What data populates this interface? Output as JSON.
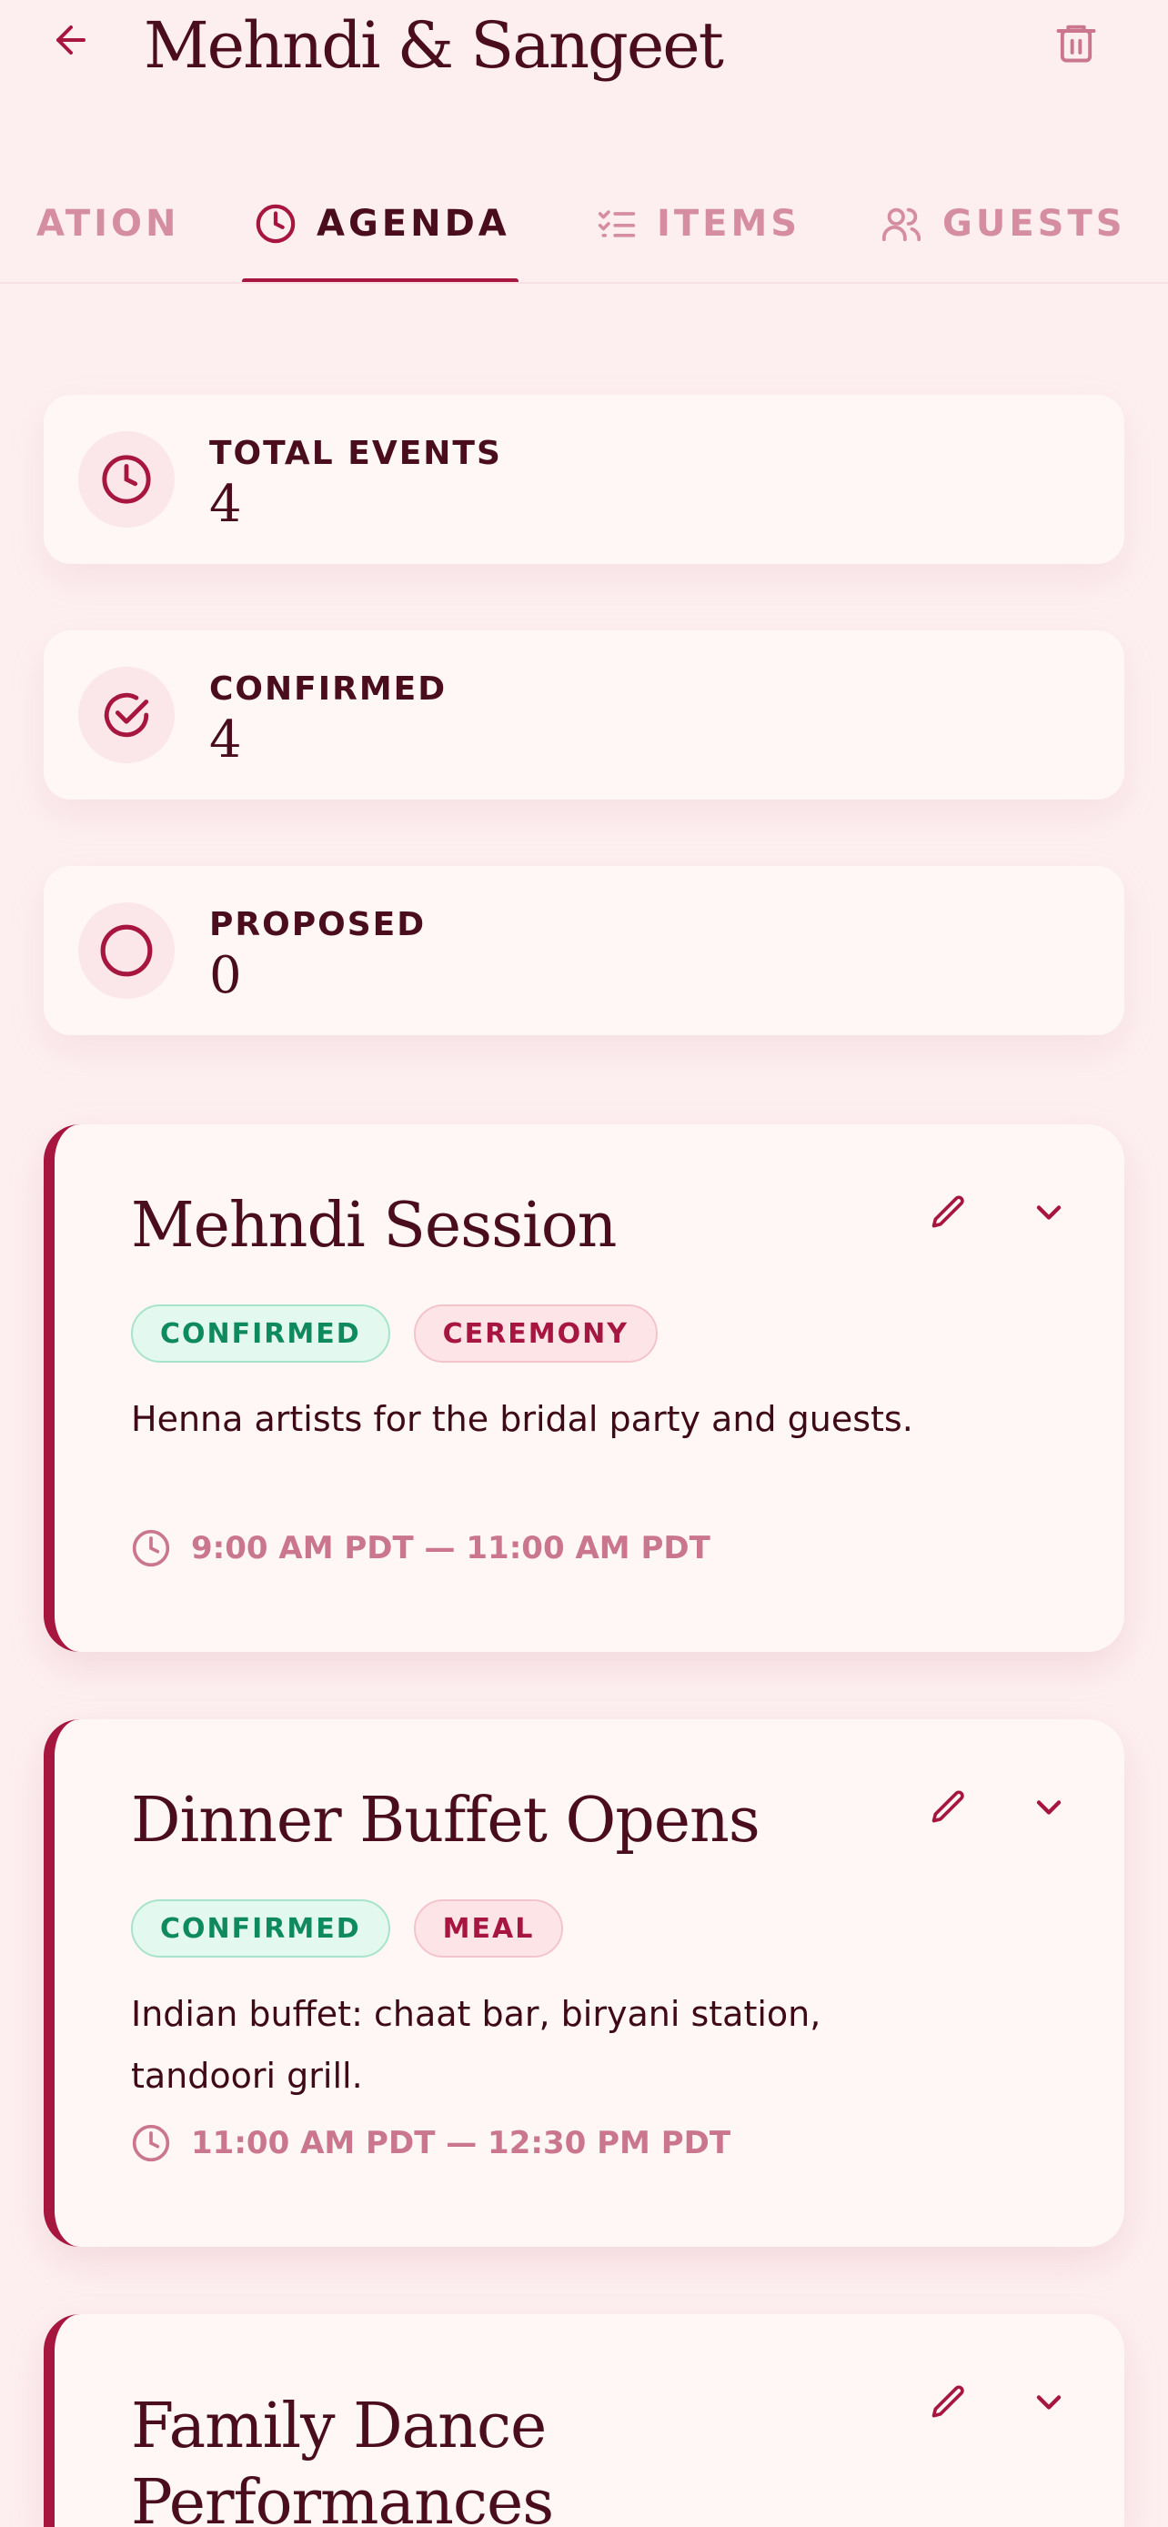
{
  "header": {
    "title": "Mehndi & Sangeet"
  },
  "tabs": [
    {
      "label": "ATION",
      "icon": "none",
      "active": false
    },
    {
      "label": "AGENDA",
      "icon": "clock-icon",
      "active": true
    },
    {
      "label": "ITEMS",
      "icon": "checklist-icon",
      "active": false
    },
    {
      "label": "GUESTS",
      "icon": "users-icon",
      "active": false
    }
  ],
  "stats": [
    {
      "label": "TOTAL EVENTS",
      "value": "4",
      "icon": "clock-icon"
    },
    {
      "label": "CONFIRMED",
      "value": "4",
      "icon": "check-circle-icon"
    },
    {
      "label": "PROPOSED",
      "value": "0",
      "icon": "circle-icon"
    }
  ],
  "events": [
    {
      "title": "Mehndi Session",
      "status": "CONFIRMED",
      "type": "CEREMONY",
      "description": "Henna artists for the bridal party and guests.",
      "time": "9:00 AM PDT — 11:00 AM PDT"
    },
    {
      "title": "Dinner Buffet Opens",
      "status": "CONFIRMED",
      "type": "MEAL",
      "description": "Indian buffet: chaat bar, biryani station, tandoori grill.",
      "time": "11:00 AM PDT — 12:30 PM PDT"
    },
    {
      "title": "Family Dance Performances"
    }
  ],
  "colors": {
    "background": "#fdeff0",
    "accent": "#a6163f",
    "text": "#4a0d1e",
    "confirmed": "#0f8a5f",
    "muted": "#d58ea1"
  }
}
